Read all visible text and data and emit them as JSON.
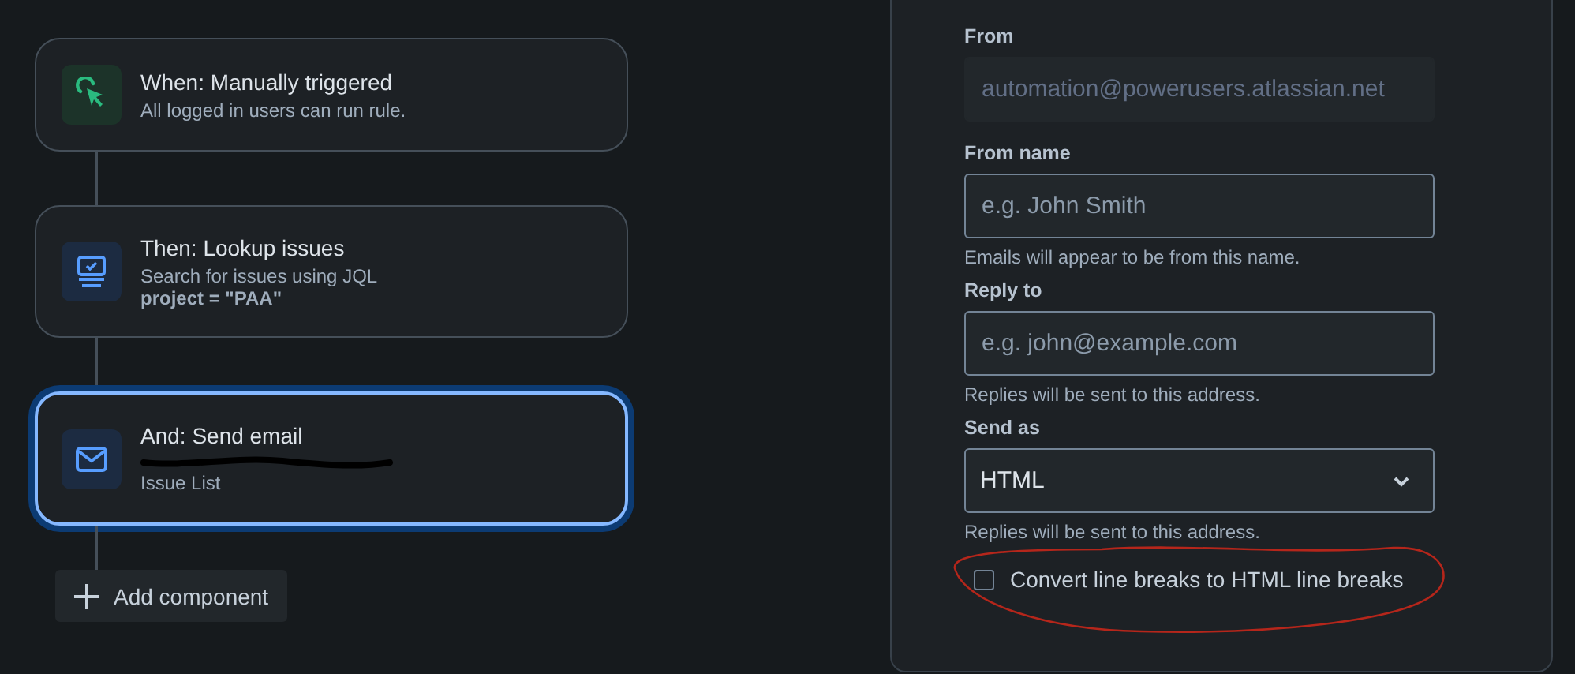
{
  "steps": [
    {
      "kind": "trigger",
      "title": "When: Manually triggered",
      "lines": [
        {
          "kind": "text",
          "text": "All logged in users can run rule.",
          "bold": false
        }
      ],
      "selected": false
    },
    {
      "kind": "lookup",
      "title": "Then: Lookup issues",
      "lines": [
        {
          "kind": "text",
          "text": "Search for issues using JQL",
          "bold": false
        },
        {
          "kind": "text",
          "text": "project = \"PAA\"",
          "bold": true
        }
      ],
      "selected": false
    },
    {
      "kind": "email",
      "title": "And: Send email",
      "lines": [
        {
          "kind": "redacted"
        },
        {
          "kind": "text",
          "text": "Issue List",
          "bold": false
        }
      ],
      "selected": true
    }
  ],
  "add_button": {
    "label": "Add component"
  },
  "form": {
    "fields": [
      {
        "kind": "text",
        "label": "From",
        "value": "automation@powerusers.atlassian.net",
        "disabled": true
      },
      {
        "kind": "text",
        "label": "From name",
        "placeholder": "e.g. John Smith",
        "help": "Emails will appear to be from this name.",
        "disabled": false
      },
      {
        "kind": "text",
        "label": "Reply to",
        "placeholder": "e.g. john@example.com",
        "help": "Replies will be sent to this address.",
        "disabled": false
      },
      {
        "kind": "select",
        "label": "Send as",
        "value": "HTML",
        "help": "Replies will be sent to this address.",
        "disabled": false
      }
    ],
    "checkbox": {
      "label": "Convert line breaks to HTML line breaks",
      "checked": false,
      "circled": true
    }
  }
}
